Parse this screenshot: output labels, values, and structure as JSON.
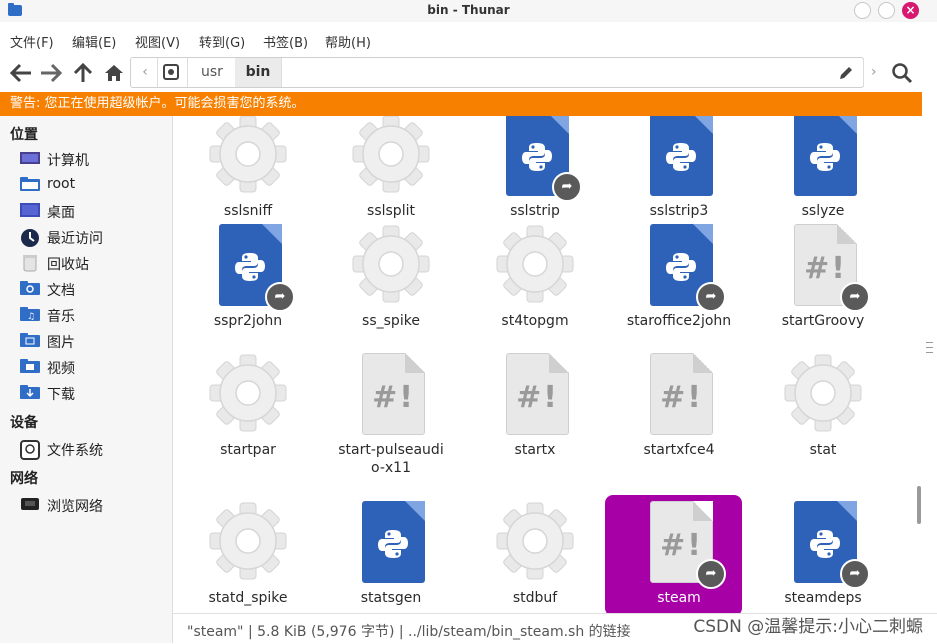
{
  "window": {
    "title": "bin - Thunar",
    "app_icon": "folder-icon"
  },
  "menu": [
    "文件(F)",
    "编辑(E)",
    "视图(V)",
    "转到(G)",
    "书签(B)",
    "帮助(H)"
  ],
  "path": {
    "segments": [
      "usr",
      "bin"
    ],
    "active": "bin"
  },
  "warning": "警告: 您正在使用超级帐户。可能会损害您的系统。",
  "sidebar": {
    "places_header": "位置",
    "places": [
      {
        "label": "计算机",
        "icon": "computer-icon"
      },
      {
        "label": "root",
        "icon": "home-folder-icon"
      },
      {
        "label": "桌面",
        "icon": "desktop-icon"
      },
      {
        "label": "最近访问",
        "icon": "recent-icon"
      },
      {
        "label": "回收站",
        "icon": "trash-icon"
      },
      {
        "label": "文档",
        "icon": "documents-folder-icon"
      },
      {
        "label": "音乐",
        "icon": "music-folder-icon"
      },
      {
        "label": "图片",
        "icon": "pictures-folder-icon"
      },
      {
        "label": "视频",
        "icon": "videos-folder-icon"
      },
      {
        "label": "下载",
        "icon": "downloads-folder-icon"
      }
    ],
    "devices_header": "设备",
    "devices": [
      {
        "label": "文件系统",
        "icon": "drive-icon"
      }
    ],
    "network_header": "网络",
    "network": [
      {
        "label": "浏览网络",
        "icon": "network-icon"
      }
    ]
  },
  "files": [
    {
      "name": "sslsniff",
      "type": "gear"
    },
    {
      "name": "sslsplit",
      "type": "gear"
    },
    {
      "name": "sslstrip",
      "type": "python",
      "link": true
    },
    {
      "name": "sslstrip3",
      "type": "python"
    },
    {
      "name": "sslyze",
      "type": "python"
    },
    {
      "name": "sspr2john",
      "type": "python",
      "link": true
    },
    {
      "name": "ss_spike",
      "type": "gear"
    },
    {
      "name": "st4topgm",
      "type": "gear"
    },
    {
      "name": "staroffice2john",
      "type": "python",
      "link": true
    },
    {
      "name": "startGroovy",
      "type": "script",
      "link": true
    },
    {
      "name": "startpar",
      "type": "gear"
    },
    {
      "name": "start-pulseaudio-x11",
      "type": "script"
    },
    {
      "name": "startx",
      "type": "script"
    },
    {
      "name": "startxfce4",
      "type": "script"
    },
    {
      "name": "stat",
      "type": "gear"
    },
    {
      "name": "statd_spike",
      "type": "gear"
    },
    {
      "name": "statsgen",
      "type": "python"
    },
    {
      "name": "stdbuf",
      "type": "gear"
    },
    {
      "name": "steam",
      "type": "script",
      "link": true,
      "selected": true
    },
    {
      "name": "steamdeps",
      "type": "python",
      "link": true
    }
  ],
  "status": "\"steam\" | 5.8 KiB (5,976 字节) | ../lib/steam/bin_steam.sh 的链接",
  "watermark": "CSDN @温馨提示:小心二刺螈",
  "colors": {
    "warning": "#f78000",
    "selection": "#a600a6",
    "python": "#2e62b9"
  }
}
